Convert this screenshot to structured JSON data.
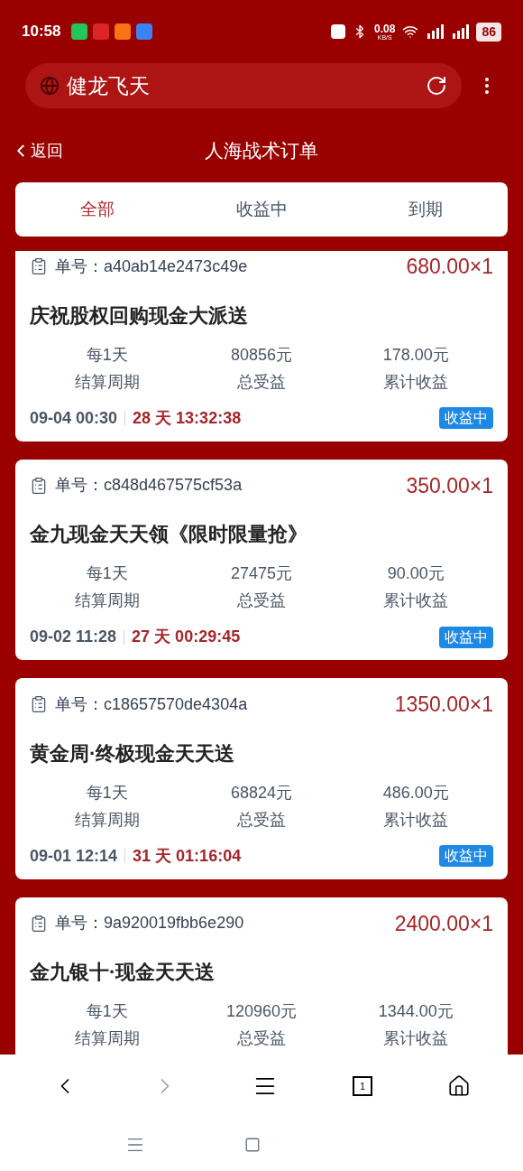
{
  "status_bar": {
    "time": "10:58",
    "network_speed": "0.08",
    "network_unit": "KB/S",
    "battery": "86"
  },
  "address_bar": {
    "text": "健龙飞天"
  },
  "header": {
    "back": "返回",
    "title": "人海战术订单"
  },
  "tabs": [
    {
      "label": "全部",
      "selected": true
    },
    {
      "label": "收益中",
      "selected": false
    },
    {
      "label": "到期",
      "selected": false
    }
  ],
  "orders": [
    {
      "order_label": "单号：",
      "order_no": "a40ab14e2473c49e",
      "price": "680.00×1",
      "name": "庆祝股权回购现金大派送",
      "stats": [
        {
          "value": "每1天",
          "label": "结算周期"
        },
        {
          "value": "80856元",
          "label": "总受益"
        },
        {
          "value": "178.00元",
          "label": "累计收益"
        }
      ],
      "date": "09-04 00:30",
      "countdown": "28 天 13:32:38",
      "status": "收益中"
    },
    {
      "order_label": "单号：",
      "order_no": "c848d467575cf53a",
      "price": "350.00×1",
      "name": "金九现金天天领《限时限量抢》",
      "stats": [
        {
          "value": "每1天",
          "label": "结算周期"
        },
        {
          "value": "27475元",
          "label": "总受益"
        },
        {
          "value": "90.00元",
          "label": "累计收益"
        }
      ],
      "date": "09-02 11:28",
      "countdown": "27 天 00:29:45",
      "status": "收益中"
    },
    {
      "order_label": "单号：",
      "order_no": "c18657570de4304a",
      "price": "1350.00×1",
      "name": "黄金周·终极现金天天送",
      "stats": [
        {
          "value": "每1天",
          "label": "结算周期"
        },
        {
          "value": "68824元",
          "label": "总受益"
        },
        {
          "value": "486.00元",
          "label": "累计收益"
        }
      ],
      "date": "09-01 12:14",
      "countdown": "31 天 01:16:04",
      "status": "收益中"
    },
    {
      "order_label": "单号：",
      "order_no": "9a920019fbb6e290",
      "price": "2400.00×1",
      "name": "金九银十·现金天天送",
      "stats": [
        {
          "value": "每1天",
          "label": "结算周期"
        },
        {
          "value": "120960元",
          "label": "总受益"
        },
        {
          "value": "1344.00元",
          "label": "累计收益"
        }
      ]
    }
  ],
  "browser_nav": {
    "tab_count": "1"
  }
}
